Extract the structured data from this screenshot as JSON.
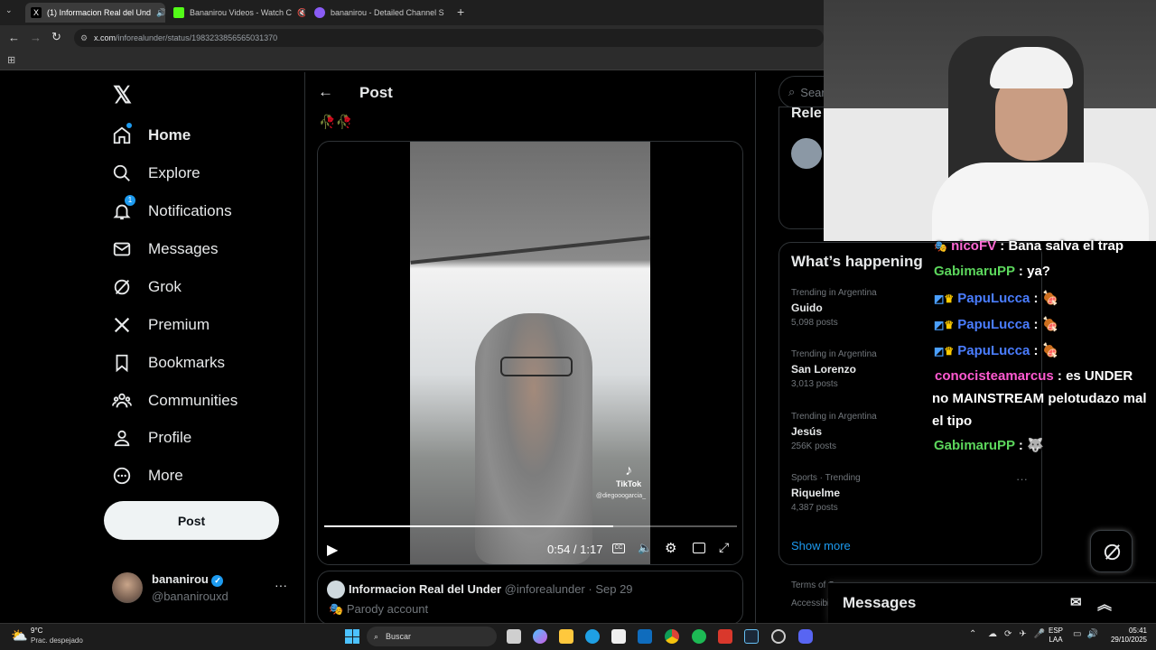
{
  "browser": {
    "tabs": [
      {
        "title": "(1) Informacion Real del Und",
        "active": true
      },
      {
        "title": "Bananirou Videos - Watch C",
        "active": false
      },
      {
        "title": "bananirou - Detailed Channel S",
        "active": false
      }
    ],
    "new_tab": "+",
    "url_host": "x.com",
    "url_path": "/inforealunder/status/1983233856565031370"
  },
  "nav": {
    "items": [
      {
        "label": "Home",
        "icon": "home-icon"
      },
      {
        "label": "Explore",
        "icon": "search-icon"
      },
      {
        "label": "Notifications",
        "icon": "bell-icon",
        "badge": "1"
      },
      {
        "label": "Messages",
        "icon": "mail-icon"
      },
      {
        "label": "Grok",
        "icon": "grok-icon"
      },
      {
        "label": "Premium",
        "icon": "x-logo-icon"
      },
      {
        "label": "Bookmarks",
        "icon": "bookmark-icon"
      },
      {
        "label": "Communities",
        "icon": "people-icon"
      },
      {
        "label": "Profile",
        "icon": "person-icon"
      },
      {
        "label": "More",
        "icon": "more-circle-icon"
      }
    ],
    "post_button": "Post",
    "account": {
      "name": "bananirou",
      "handle": "@bananirouxd",
      "menu": "···"
    }
  },
  "post": {
    "header_title": "Post",
    "emoji_line": "🥀🥀",
    "video": {
      "current_time": "0:54",
      "duration": "1:17",
      "time_display": "0:54 / 1:17",
      "progress": 0.7,
      "watermark": "TikTok",
      "watermark_handle": "@diegooogarcia_"
    },
    "quoted": {
      "name": "Informacion Real del Under",
      "handle": "@inforealunder",
      "date": "· Sep 29",
      "label": "Parody account"
    }
  },
  "sidebar": {
    "search_placeholder": "Sear",
    "relevant_header": "Rele",
    "whats_happening": "What’s happening",
    "trends": [
      {
        "category": "Trending in Argentina",
        "name": "Guido",
        "count": "5,098 posts"
      },
      {
        "category": "Trending in Argentina",
        "name": "San Lorenzo",
        "count": "3,013 posts"
      },
      {
        "category": "Trending in Argentina",
        "name": "Jesús",
        "count": "256K posts"
      },
      {
        "category": "Sports · Trending",
        "name": "Riquelme",
        "count": "4,387 posts"
      }
    ],
    "show_more": "Show more",
    "footer_1": "Terms of Se",
    "footer_2": "Accessibili"
  },
  "chat": {
    "lines": [
      {
        "user": "nicoFV",
        "text": " : Bana salva el trap",
        "color": "#ff6bd6"
      },
      {
        "user": "GabimaruPP",
        "text": " : ya?",
        "color": "#5cd65c"
      },
      {
        "user": "PapuLucca",
        "text": " : 🍖",
        "color": "#4a7dff"
      },
      {
        "user": "PapuLucca",
        "text": " : 🍖",
        "color": "#4a7dff"
      },
      {
        "user": "PapuLucca",
        "text": " : 🍖",
        "color": "#4a7dff"
      },
      {
        "user": "conocisteamarcus",
        "text": " : es UNDER no MAINSTREAM pelotudazo mal el tipo",
        "color": "#ff5ad1"
      },
      {
        "user": "GabimaruPP",
        "text": " : 🐺",
        "color": "#5cd65c"
      }
    ]
  },
  "messages_drawer": {
    "title": "Messages"
  },
  "taskbar": {
    "weather_temp": "9°C",
    "weather_desc": "Prac. despejado",
    "search_placeholder": "Buscar",
    "lang": "ESP",
    "lang2": "LAA",
    "time": "05:41",
    "date": "29/10/2025"
  }
}
